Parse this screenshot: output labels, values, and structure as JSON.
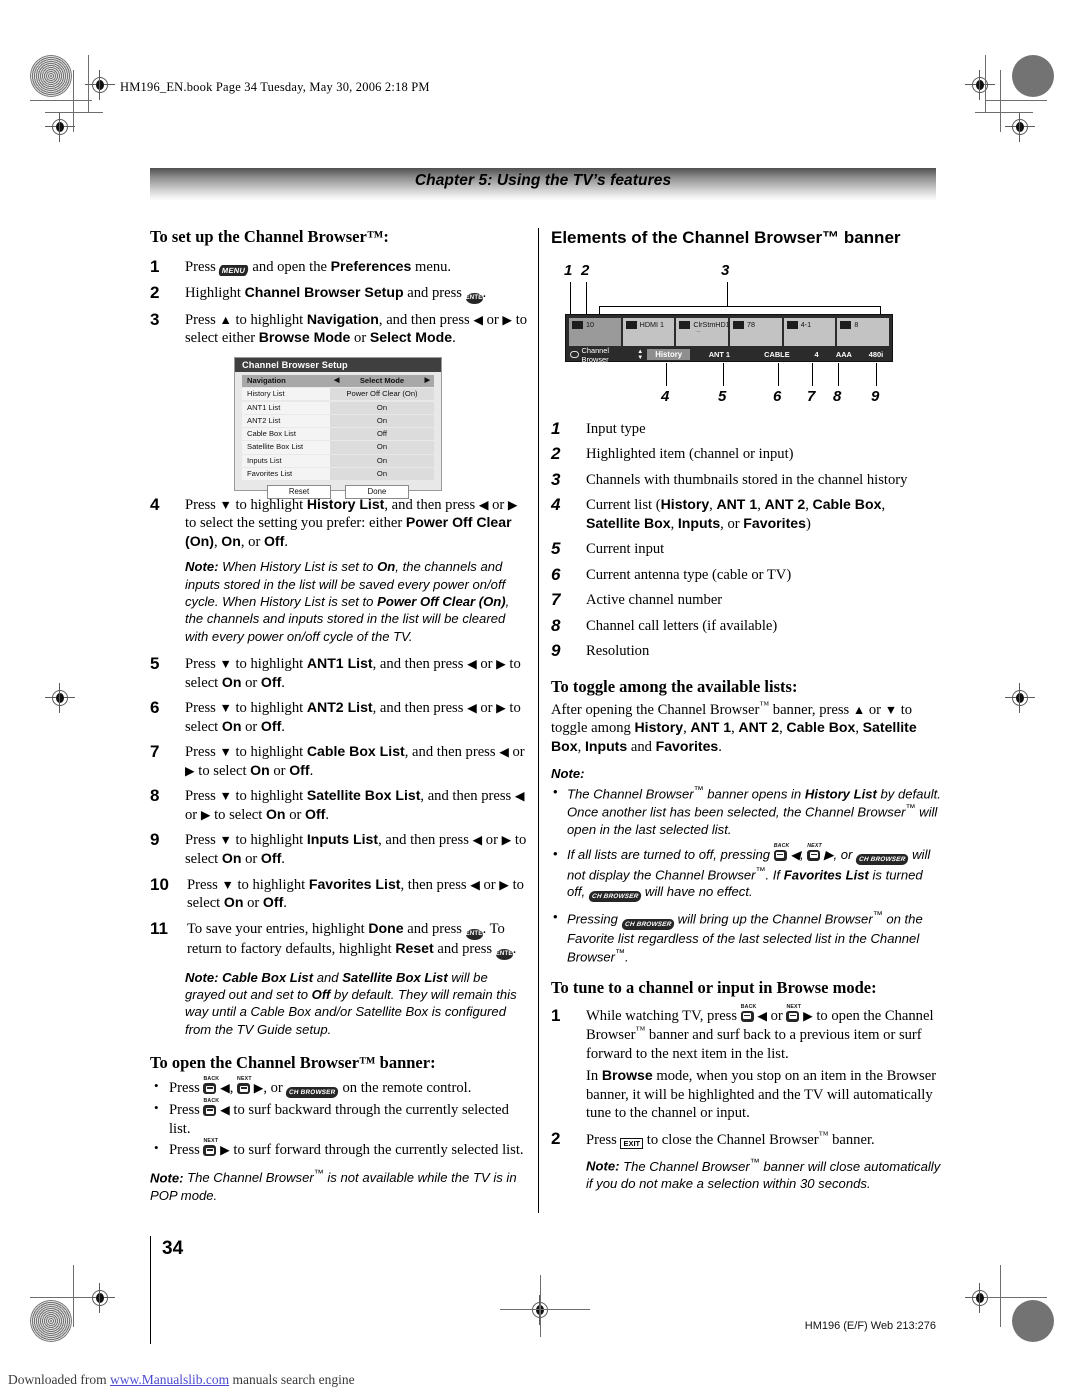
{
  "book_header": "HM196_EN.book  Page 34  Tuesday, May 30, 2006  2:18 PM",
  "chapter_bar": "Chapter 5: Using the TV’s features",
  "left_column": {
    "heading": "To set up the Channel Browser™:",
    "steps": [
      {
        "n": "1",
        "text_a": "Press ",
        "key": "MENU",
        "text_b": " and open the ",
        "bold": "Preferences",
        "text_c": " menu."
      },
      {
        "n": "2",
        "text_a": "Highlight ",
        "bold": "Channel Browser Setup",
        "text_b": " and press ",
        "key": "ENTER",
        "text_c": "."
      },
      {
        "n": "3",
        "text": "Press ▲ to highlight Navigation, and then press ◀ or ▶ to select either Browse Mode or Select Mode."
      },
      {
        "n": "4",
        "text": "Press ▼ to highlight History List, and then press ◀ or ▶ to select the setting you prefer: either Power Off Clear (On), On, or Off."
      },
      {
        "n": "5",
        "text": "Press ▼ to highlight ANT1 List, and then press ◀ or ▶ to select On or Off."
      },
      {
        "n": "6",
        "text": "Press ▼ to highlight ANT2 List, and then press ◀ or ▶ to select On or Off."
      },
      {
        "n": "7",
        "text": "Press ▼ to highlight Cable Box List, and then press ◀ or ▶ to select On or Off."
      },
      {
        "n": "8",
        "text": "Press ▼ to highlight Satellite Box List, and then press ◀ or ▶ to select On or Off."
      },
      {
        "n": "9",
        "text": "Press ▼ to highlight Inputs List, and then press ◀ or ▶ to select On or Off."
      },
      {
        "n": "10",
        "text": "Press ▼ to highlight Favorites List, then press ◀ or ▶ to select On or Off."
      },
      {
        "n": "11",
        "text": "To save your entries, highlight Done and press ENTER. To return to factory defaults, highlight Reset and press ENTER."
      }
    ],
    "note_history": {
      "label": "Note:",
      "body": "When History List is set to On, the channels and inputs stored in the list will be saved every power on/off cycle. When History List is set to Power Off Clear (On), the channels and inputs stored in the list will be cleared with every power on/off cycle of the TV."
    },
    "note_cablebox": {
      "label": "Note:",
      "body": "Cable Box List and Satellite Box List will be grayed out and set to Off by default. They will remain this way until a Cable Box and/or Satellite Box is configured from the TV Guide setup."
    },
    "open_banner": {
      "heading": "To open the Channel Browser™ banner:",
      "bullets": [
        "Press CH-BACK ◀, CH-NEXT ▶, or CH BROWSER on the remote control.",
        "Press CH-BACK ◀ to surf backward through the currently selected list.",
        "Press CH-NEXT ▶ to surf forward through the currently selected list."
      ],
      "note": {
        "label": "Note:",
        "body": "The Channel Browser™ is not available while the TV is in POP mode."
      }
    }
  },
  "setup_menu": {
    "title": "Channel Browser Setup",
    "rows": [
      {
        "label": "Navigation",
        "value": "Select Mode",
        "highlighted": true,
        "left_arrow": "◀",
        "right_arrow": "▶"
      },
      {
        "label": "History List",
        "value": "Power Off Clear (On)",
        "highlighted": false
      },
      {
        "label": "ANT1 List",
        "value": "On",
        "highlighted": false
      },
      {
        "label": "ANT2 List",
        "value": "On",
        "highlighted": false
      },
      {
        "label": "Cable Box List",
        "value": "Off",
        "highlighted": false
      },
      {
        "label": "Satellite Box List",
        "value": "On",
        "highlighted": false
      },
      {
        "label": "Inputs List",
        "value": "On",
        "highlighted": false
      },
      {
        "label": "Favorites List",
        "value": "On",
        "highlighted": false
      }
    ],
    "buttons": {
      "reset": "Reset",
      "done": "Done"
    }
  },
  "right_column": {
    "heading": "Elements of the Channel Browser™ banner",
    "callouts_top": [
      "1",
      "2",
      "3"
    ],
    "callouts_bottom": [
      "4",
      "5",
      "6",
      "7",
      "8",
      "9"
    ],
    "banner": {
      "tiles": [
        {
          "icon": "antenna-icon",
          "label": "10",
          "selected": true,
          "sub": ""
        },
        {
          "icon": "hdmi-icon",
          "label": "HDMI 1",
          "selected": false,
          "sub": ""
        },
        {
          "icon": "cable-icon",
          "label": "ClrStmHD1",
          "selected": false,
          "sub": "—"
        },
        {
          "icon": "satellite-icon",
          "label": "78",
          "selected": false,
          "sub": ""
        },
        {
          "icon": "antenna-icon",
          "label": "4-1",
          "selected": false,
          "sub": ""
        },
        {
          "icon": "antenna-icon",
          "label": "8",
          "selected": false,
          "sub": ""
        }
      ],
      "status": {
        "brand": "Channel Browser",
        "list": "History",
        "input": "ANT 1",
        "antenna": "CABLE",
        "channel": "4",
        "call_letters": "AAA",
        "resolution": "480i"
      }
    },
    "legend": [
      {
        "n": "1",
        "text": "Input type"
      },
      {
        "n": "2",
        "text": "Highlighted item (channel or input)"
      },
      {
        "n": "3",
        "text": "Channels with thumbnails stored in the channel history"
      },
      {
        "n": "4",
        "text": "Current list (History, ANT 1, ANT 2, Cable Box, Satellite Box, Inputs, or Favorites)"
      },
      {
        "n": "5",
        "text": "Current input"
      },
      {
        "n": "6",
        "text": "Current antenna type (cable or TV)"
      },
      {
        "n": "7",
        "text": "Active channel number"
      },
      {
        "n": "8",
        "text": "Channel call letters (if available)"
      },
      {
        "n": "9",
        "text": "Resolution"
      }
    ],
    "toggle": {
      "heading": "To toggle among the available lists:",
      "body": "After opening the Channel Browser™ banner, press ▲ or ▼ to toggle among History, ANT 1, ANT 2, Cable Box, Satellite Box, Inputs and Favorites.",
      "note_label": "Note:",
      "notes": [
        "The Channel Browser™ banner opens in History List by default. Once another list has been selected, the Channel Browser™ will open in the last selected list.",
        "If all lists are turned to off, pressing CH-BACK ◀, CH-NEXT ▶, or CH BROWSER will not display the Channel Browser™. If Favorites List is turned off, CH BROWSER will have no effect.",
        "Pressing CH BROWSER will bring up the Channel Browser™ on the Favorite list regardless of the last selected list in the Channel Browser™."
      ]
    },
    "browse": {
      "heading": "To tune to a channel or input in Browse mode:",
      "step1_a": "While watching TV, press CH-BACK ◀ or CH-NEXT ▶ to open the Channel Browser™ banner and surf back to a previous item or surf forward to the next item in the list.",
      "step1_b": "In Browse mode, when you stop on an item in the Browser banner, it will be highlighted and the TV will automatically tune to the channel or input.",
      "step2": "Press EXIT to close the Channel Browser™ banner.",
      "note_label": "Note:",
      "note_body": "The Channel Browser™ banner will close automatically if you do not make a selection within 30 seconds."
    }
  },
  "footer": {
    "page_number": "34",
    "code": "HM196 (E/F) Web 213:276",
    "download_pre": "Downloaded from ",
    "download_link": "www.Manualslib.com",
    "download_post": " manuals search engine"
  },
  "keys": {
    "menu": "MENU",
    "enter": "ENTER",
    "browser": "CH BROWSER",
    "exit": "EXIT",
    "ch_back": "BACK",
    "ch_next": "NEXT"
  }
}
